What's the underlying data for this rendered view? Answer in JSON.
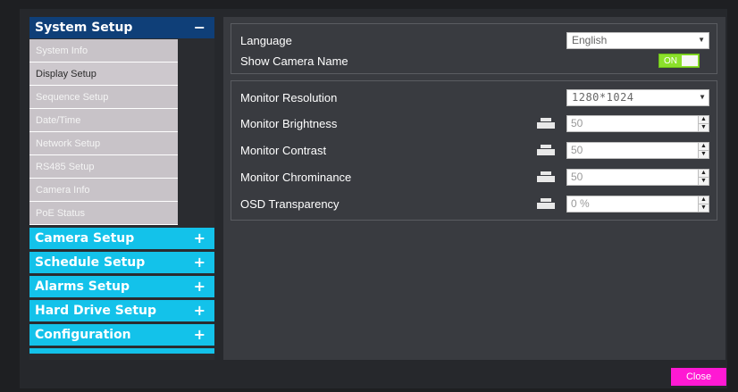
{
  "sidebar": {
    "active_section": {
      "label": "System Setup",
      "symbol": "−"
    },
    "sub_items": [
      {
        "label": "System Info"
      },
      {
        "label": "Display Setup"
      },
      {
        "label": "Sequence Setup"
      },
      {
        "label": "Date/Time"
      },
      {
        "label": "Network Setup"
      },
      {
        "label": "RS485 Setup"
      },
      {
        "label": "Camera Info"
      },
      {
        "label": "PoE Status"
      }
    ],
    "sections": [
      {
        "label": "Camera Setup",
        "symbol": "+"
      },
      {
        "label": "Schedule Setup",
        "symbol": "+"
      },
      {
        "label": "Alarms Setup",
        "symbol": "+"
      },
      {
        "label": "Hard Drive Setup",
        "symbol": "+"
      },
      {
        "label": "Configuration",
        "symbol": "+"
      }
    ]
  },
  "general": {
    "language": {
      "label": "Language",
      "value": "English"
    },
    "show_camera_name": {
      "label": "Show Camera Name",
      "value": "ON"
    }
  },
  "monitor": {
    "resolution": {
      "label": "Monitor Resolution",
      "value": "1280*1024"
    },
    "brightness": {
      "label": "Monitor Brightness",
      "value": "50"
    },
    "contrast": {
      "label": "Monitor Contrast",
      "value": "50"
    },
    "chrominance": {
      "label": "Monitor Chrominance",
      "value": "50"
    },
    "osd_transparency": {
      "label": "OSD Transparency",
      "value": "0 %"
    }
  },
  "footer": {
    "close_label": "Close"
  },
  "colors": {
    "section_active": "#0f3f78",
    "section_collapsed": "#13c2ea",
    "toggle_on": "#8be02b",
    "close_button": "#ff19d3"
  },
  "icons": {
    "slider": "slider-icon",
    "dropdown": "chevron-down-icon",
    "spin_up": "spin-up-icon",
    "spin_down": "spin-down-icon"
  }
}
